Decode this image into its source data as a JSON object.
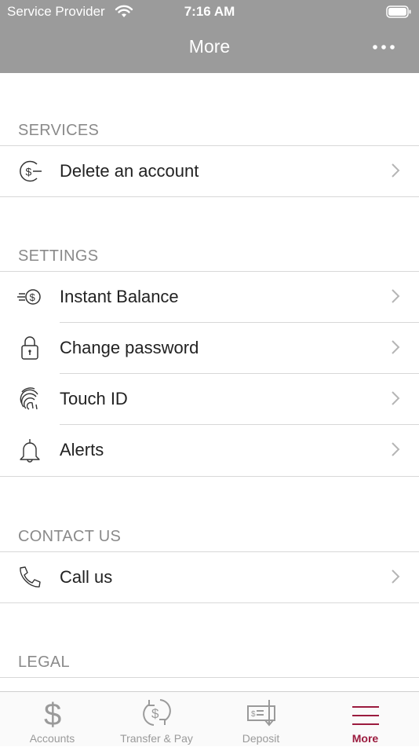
{
  "status_bar": {
    "carrier": "Service Provider",
    "time": "7:16 AM"
  },
  "nav": {
    "title": "More"
  },
  "sections": {
    "services": {
      "title": "SERVICES",
      "items": [
        {
          "label": "Delete an account",
          "icon": "dollar-circle-icon"
        }
      ]
    },
    "settings": {
      "title": "SETTINGS",
      "items": [
        {
          "label": "Instant Balance",
          "icon": "instant-balance-icon"
        },
        {
          "label": "Change password",
          "icon": "lock-icon"
        },
        {
          "label": "Touch ID",
          "icon": "fingerprint-icon"
        },
        {
          "label": "Alerts",
          "icon": "bell-icon"
        }
      ]
    },
    "contact": {
      "title": "CONTACT US",
      "items": [
        {
          "label": "Call us",
          "icon": "phone-icon"
        }
      ]
    },
    "legal": {
      "title": "LEGAL"
    }
  },
  "tabbar": {
    "tabs": [
      {
        "label": "Accounts",
        "icon": "dollar-icon"
      },
      {
        "label": "Transfer & Pay",
        "icon": "transfer-icon"
      },
      {
        "label": "Deposit",
        "icon": "deposit-check-icon"
      },
      {
        "label": "More",
        "icon": "menu-icon",
        "active": true
      }
    ]
  },
  "colors": {
    "header_bg": "#9b9b9b",
    "accent": "#9b1b3e",
    "inactive": "#9a9a9a"
  }
}
